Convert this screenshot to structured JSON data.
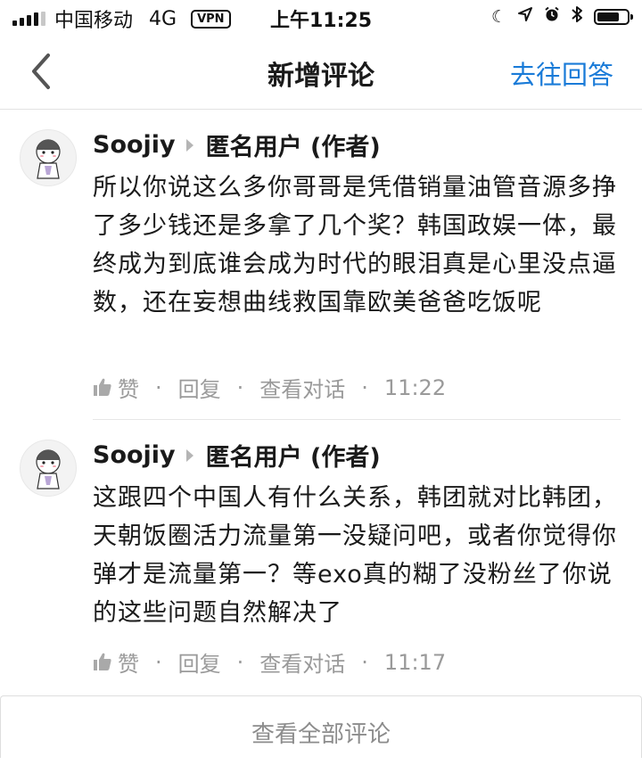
{
  "status_bar": {
    "carrier": "中国移动",
    "network": "4G",
    "vpn": "VPN",
    "time": "上午11:25"
  },
  "nav": {
    "title": "新增评论",
    "action_label": "去往回答"
  },
  "comments": [
    {
      "author": "Soojiy",
      "reply_to": "匿名用户 (作者)",
      "body": "所以你说这么多你哥哥是凭借销量油管音源多挣了多少钱还是多拿了几个奖？韩国政娱一体，最终成为到底谁会成为时代的眼泪真是心里没点逼数，还在妄想曲线救国靠欧美爸爸吃饭呢",
      "like_label": "赞",
      "reply_label": "回复",
      "view_conversation_label": "查看对话",
      "time": "11:22"
    },
    {
      "author": "Soojiy",
      "reply_to": "匿名用户 (作者)",
      "body": "这跟四个中国人有什么关系，韩团就对比韩团，天朝饭圈活力流量第一没疑问吧，或者你觉得你弹才是流量第一？等exo真的糊了没粉丝了你说的这些问题自然解决了",
      "like_label": "赞",
      "reply_label": "回复",
      "view_conversation_label": "查看对话",
      "time": "11:17"
    }
  ],
  "footer": {
    "view_all_label": "查看全部评论"
  },
  "colors": {
    "accent": "#1a7bd8",
    "meta_text": "#9a9a9a",
    "body_text": "#1a1a1a"
  }
}
